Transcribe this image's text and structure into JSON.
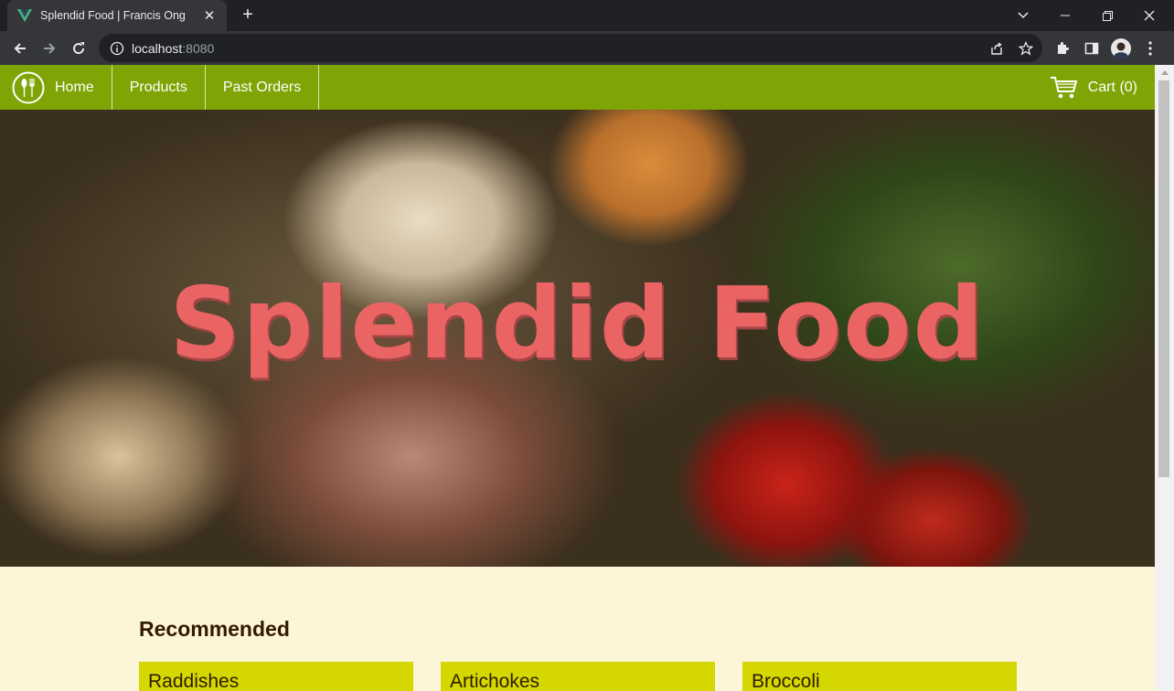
{
  "browser": {
    "tab_title": "Splendid Food | Francis Ong",
    "url_host": "localhost",
    "url_port": ":8080"
  },
  "nav": {
    "items": [
      {
        "label": "Home"
      },
      {
        "label": "Products"
      },
      {
        "label": "Past Orders"
      }
    ],
    "cart_label": "Cart (0)"
  },
  "hero": {
    "title": "Splendid Food"
  },
  "recommended": {
    "heading": "Recommended",
    "items": [
      {
        "name": "Raddishes"
      },
      {
        "name": "Artichokes"
      },
      {
        "name": "Broccoli"
      }
    ]
  },
  "colors": {
    "navbar": "#7ea505",
    "hero_title": "#ea6464",
    "card": "#d4d700",
    "page_bg": "#fdf5d8"
  }
}
